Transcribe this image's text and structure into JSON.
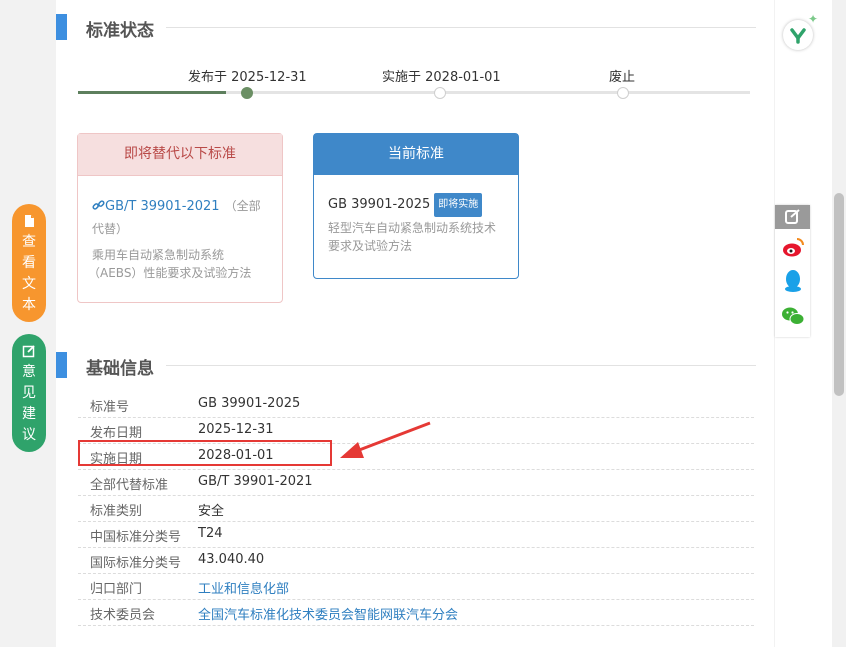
{
  "status_section": {
    "title": "标准状态",
    "timeline": {
      "published": "发布于 2025-12-31",
      "implemented": "实施于 2028-01-01",
      "abolished": "废止"
    }
  },
  "replace_card": {
    "header": "即将替代以下标准",
    "std_link": "GB/T 39901-2021",
    "replace_note_1": "（全部",
    "replace_note_2": "代替）",
    "desc_line1": "乘用车自动紧急制动系统",
    "desc_line2": "（AEBS）性能要求及试验方法"
  },
  "current_card": {
    "header": "当前标准",
    "std_no": "GB 39901-2025",
    "badge": "即将实施",
    "desc_line1": "轻型汽车自动紧急制动系统技术",
    "desc_line2": "要求及试验方法"
  },
  "basic_section": {
    "title": "基础信息",
    "rows": [
      {
        "k": "标准号",
        "v": "GB 39901-2025"
      },
      {
        "k": "发布日期",
        "v": "2025-12-31"
      },
      {
        "k": "实施日期",
        "v": "2028-01-01"
      },
      {
        "k": "全部代替标准",
        "v": "GB/T 39901-2021"
      },
      {
        "k": "标准类别",
        "v": "安全"
      },
      {
        "k": "中国标准分类号",
        "v": "T24"
      },
      {
        "k": "国际标准分类号",
        "v": "43.040.40"
      },
      {
        "k": "归口部门",
        "v": "工业和信息化部"
      },
      {
        "k": "技术委员会",
        "v": "全国汽车标准化技术委员会智能网联汽车分会"
      }
    ]
  },
  "side_buttons": {
    "view_text": [
      "查",
      "看",
      "文",
      "本"
    ],
    "feedback": [
      "意",
      "见",
      "建",
      "议"
    ]
  },
  "colors": {
    "accent_blue": "#3f88c9",
    "orange": "#f7962e",
    "green": "#2fa36b",
    "highlight_red": "#e53935"
  },
  "icons": [
    "document-icon",
    "edit-icon",
    "share-icon",
    "weibo-icon",
    "qq-icon",
    "wechat-icon",
    "link-icon",
    "logo-icon"
  ]
}
